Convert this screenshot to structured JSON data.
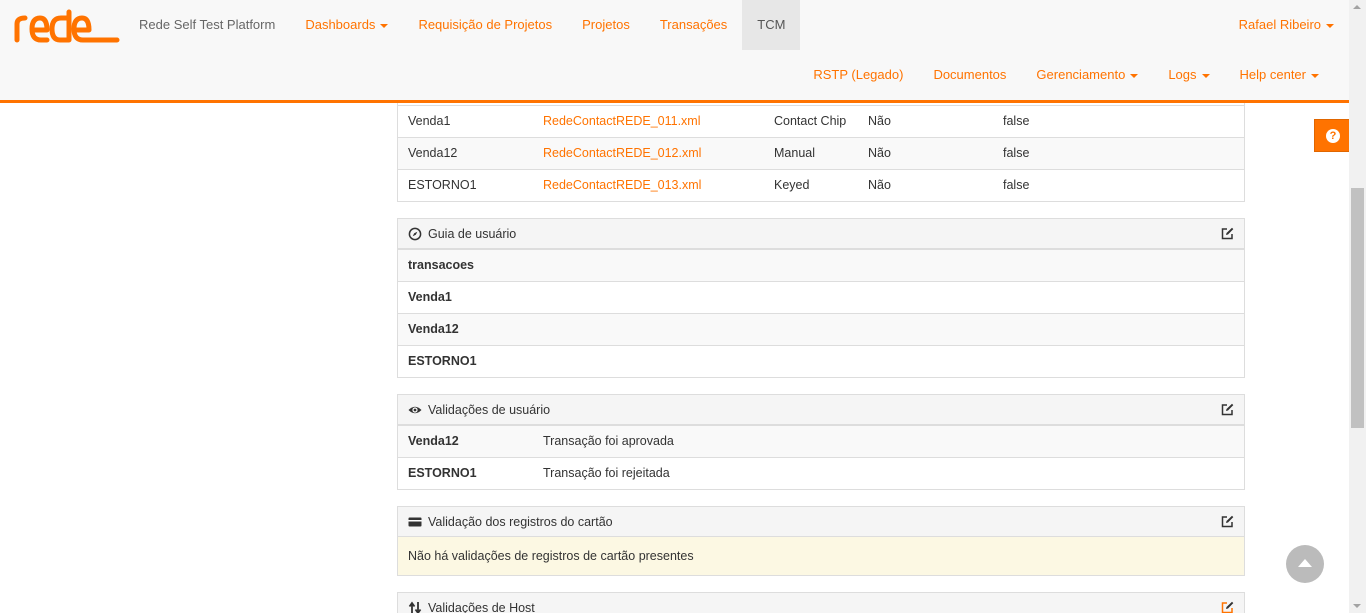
{
  "nav": {
    "brand": "Rede Self Test Platform",
    "items": [
      "Dashboards",
      "Requisição de Projetos",
      "Projetos",
      "Transações",
      "TCM"
    ],
    "user": "Rafael Ribeiro",
    "secondary": [
      "RSTP (Legado)",
      "Documentos",
      "Gerenciamento",
      "Logs",
      "Help center"
    ]
  },
  "colors": {
    "accent": "#ff7300"
  },
  "transactions_table": {
    "rows": [
      {
        "name": "Venda1",
        "file": "RedeContactREDE_011.xml",
        "type": "Contact Chip",
        "flag": "Não",
        "value": "false"
      },
      {
        "name": "Venda12",
        "file": "RedeContactREDE_012.xml",
        "type": "Manual",
        "flag": "Não",
        "value": "false"
      },
      {
        "name": "ESTORNO1",
        "file": "RedeContactREDE_013.xml",
        "type": "Keyed",
        "flag": "Não",
        "value": "false"
      }
    ]
  },
  "guia": {
    "title": "Guia de usuário",
    "icon": "compass-icon",
    "rows": [
      "transacoes",
      "Venda1",
      "Venda12",
      "ESTORNO1"
    ]
  },
  "validacoes_usuario": {
    "title": "Validações de usuário",
    "icon": "eye-icon",
    "rows": [
      {
        "name": "Venda12",
        "text": "Transação foi aprovada"
      },
      {
        "name": "ESTORNO1",
        "text": "Transação foi rejeitada"
      }
    ]
  },
  "validacao_cartao": {
    "title": "Validação dos registros do cartão",
    "icon": "credit-card-icon",
    "message": "Não há validações de registros de cartão presentes"
  },
  "validacoes_host": {
    "title": "Validações de Host",
    "icon": "sort-arrows-icon"
  }
}
